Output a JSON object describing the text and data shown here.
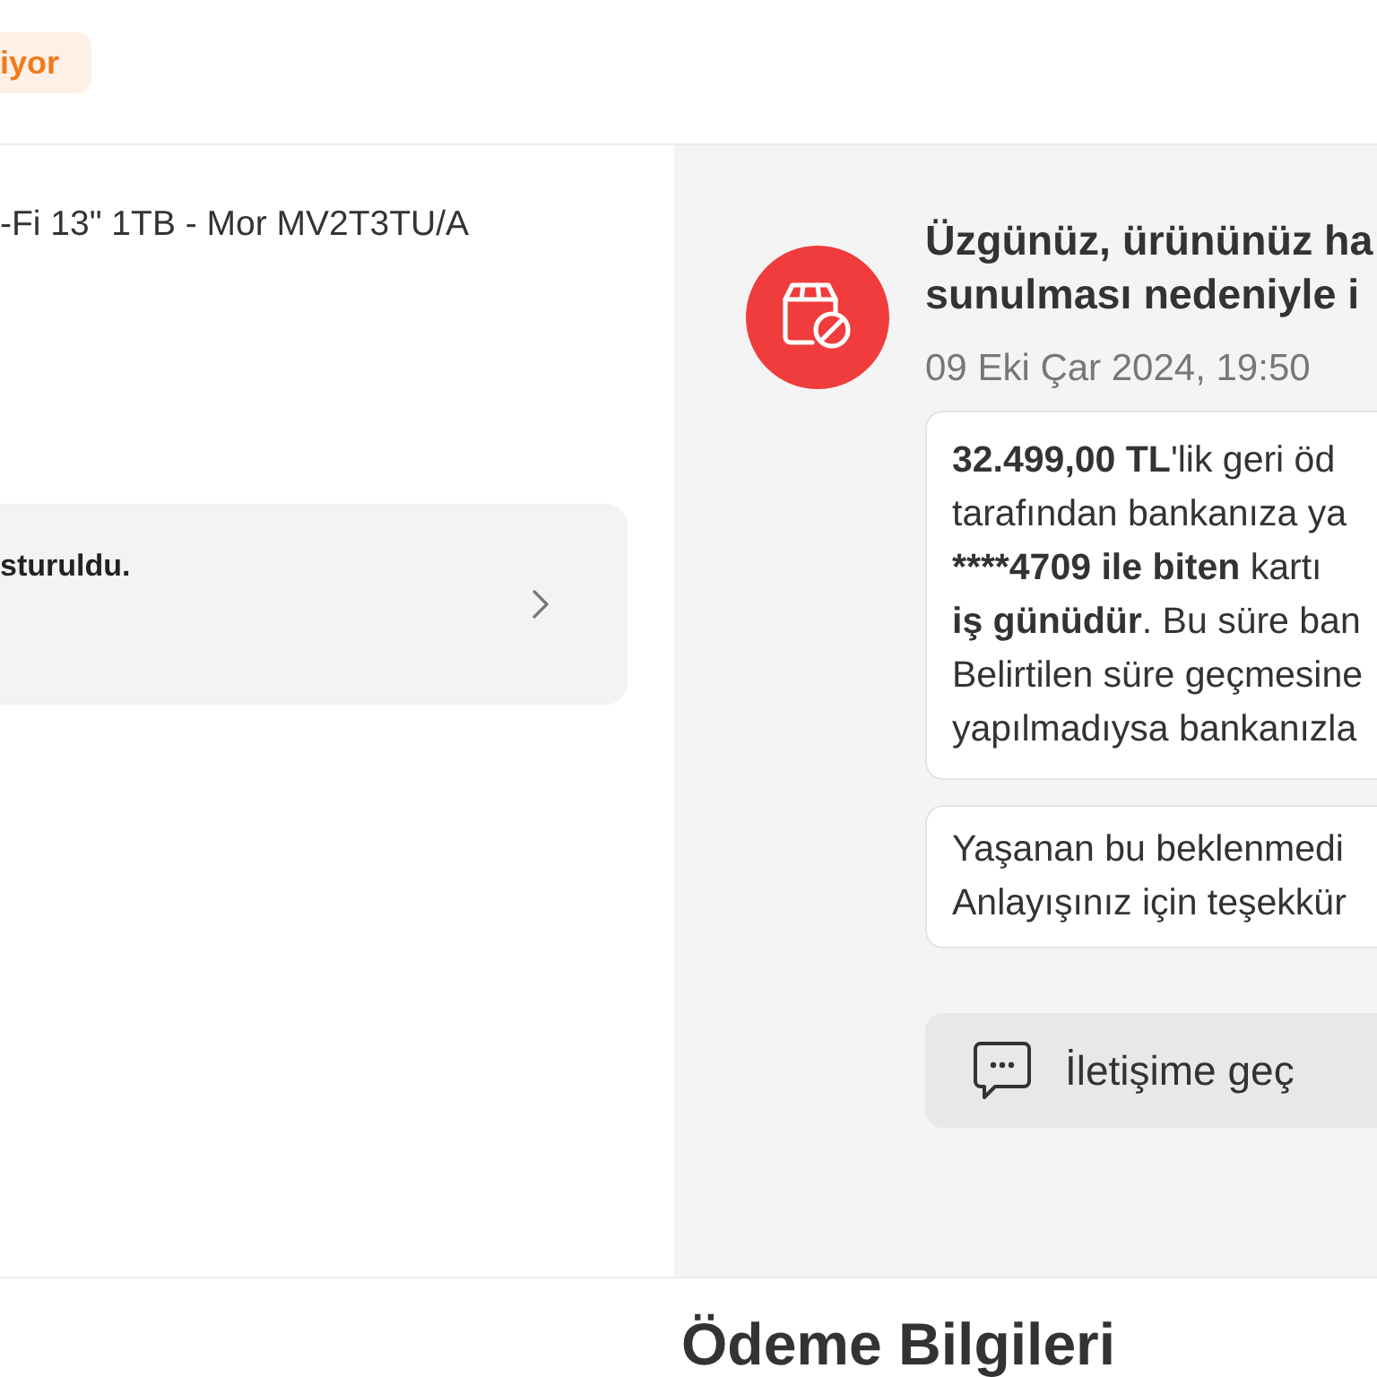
{
  "header": {
    "status_badge": "iyor"
  },
  "order": {
    "product_name": "-Fi 13\" 1TB - Mor MV2T3TU/A",
    "status_card": {
      "text": "sturuldu."
    }
  },
  "cancellation_notice": {
    "title_lines": [
      "Üzgünüz, ürününüz ha",
      "sunulması nedeniyle i"
    ],
    "date": "09 Eki Çar 2024, 19:50",
    "messages": [
      {
        "lines": [
          [
            {
              "text": "32.499,00 TL",
              "bold": true
            },
            {
              "text": "'lik geri öd",
              "bold": false
            }
          ],
          [
            {
              "text": "tarafından bankanıza ya",
              "bold": false
            }
          ],
          [
            {
              "text": "****4709 ile biten",
              "bold": true
            },
            {
              "text": " kartı",
              "bold": false
            }
          ],
          [
            {
              "text": "iş günüdür",
              "bold": true
            },
            {
              "text": ". Bu süre ban",
              "bold": false
            }
          ],
          [
            {
              "text": "Belirtilen süre geçmesine",
              "bold": false
            }
          ],
          [
            {
              "text": "yapılmadıysa bankanızla",
              "bold": false
            }
          ]
        ]
      },
      {
        "lines": [
          [
            {
              "text": "Yaşanan bu beklenmedi",
              "bold": false
            }
          ],
          [
            {
              "text": "Anlayışınız için teşekkür",
              "bold": false
            }
          ]
        ]
      }
    ],
    "contact_button": {
      "label": "İletişime geç"
    }
  },
  "payment_section": {
    "title": "Ödeme Bilgileri"
  }
}
